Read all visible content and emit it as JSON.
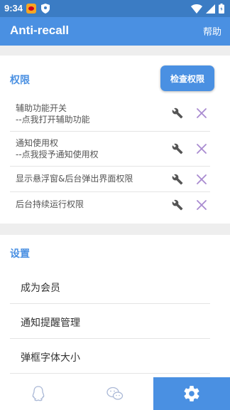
{
  "status_bar": {
    "time": "9:34"
  },
  "app_bar": {
    "title": "Anti-recall",
    "help_label": "帮助"
  },
  "permissions": {
    "section_title": "权限",
    "check_button_label": "检查权限",
    "items": [
      {
        "line1": "辅助功能开关",
        "line2": " --点我打开辅助功能"
      },
      {
        "line1": "通知使用权",
        "line2": " --点我授予通知使用权"
      },
      {
        "line1": "显示悬浮窗&后台弹出界面权限",
        "line2": ""
      },
      {
        "line1": "后台持续运行权限",
        "line2": ""
      }
    ]
  },
  "settings": {
    "section_title": "设置",
    "items": [
      {
        "label": "成为会员"
      },
      {
        "label": "通知提醒管理"
      },
      {
        "label": "弹框字体大小"
      }
    ]
  },
  "colors": {
    "primary": "#4a90e2",
    "status_bar": "#3b7cc4",
    "x_mark": "#a98bd0",
    "wrench": "#555555"
  },
  "bottom_nav": {
    "tabs": [
      "qq-icon",
      "wechat-icon",
      "settings-gear-icon"
    ],
    "active_index": 2
  }
}
